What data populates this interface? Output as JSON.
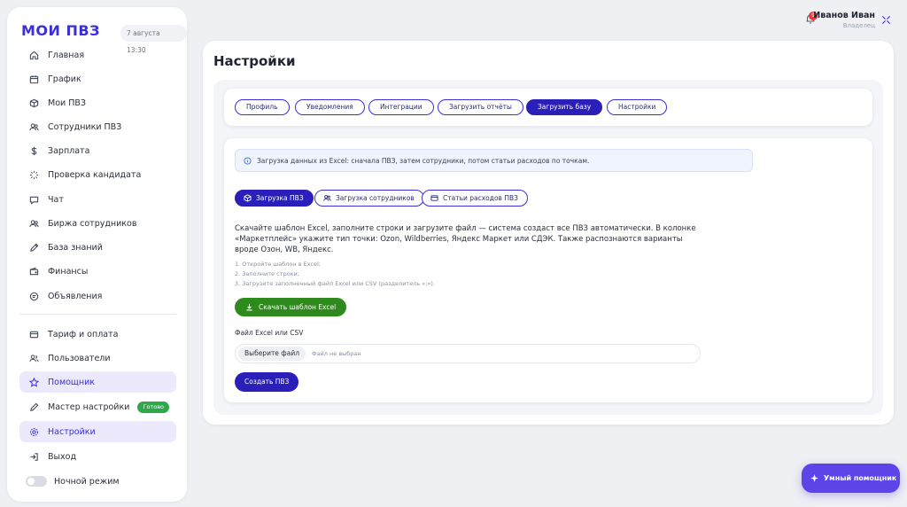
{
  "brand": {
    "logo": "МОИ ПВЗ",
    "date": "7 августа 13:30"
  },
  "sidebar": {
    "items": [
      {
        "label": "Главная",
        "icon": "home-icon"
      },
      {
        "label": "График",
        "icon": "calendar-icon"
      },
      {
        "label": "Мои ПВЗ",
        "icon": "box-icon"
      },
      {
        "label": "Сотрудники ПВЗ",
        "icon": "users-icon"
      },
      {
        "label": "Зарплата",
        "icon": "dollar-icon"
      },
      {
        "label": "Проверка кандидата",
        "icon": "loader-icon"
      },
      {
        "label": "Чат",
        "icon": "chat-icon"
      },
      {
        "label": "Биржа сотрудников",
        "icon": "users-icon"
      },
      {
        "label": "База знаний",
        "icon": "pencil-icon"
      },
      {
        "label": "Финансы",
        "icon": "wallet-icon"
      },
      {
        "label": "Объявления",
        "icon": "megaphone-icon"
      }
    ],
    "items2": [
      {
        "label": "Тариф и оплата",
        "icon": "card-icon"
      },
      {
        "label": "Пользователи",
        "icon": "user-group-icon"
      },
      {
        "label": "Помощник",
        "icon": "star-icon"
      },
      {
        "label": "Мастер настройки",
        "icon": "wand-icon",
        "badge": "Готово"
      },
      {
        "label": "Настройки",
        "icon": "gear-icon"
      },
      {
        "label": "Выход",
        "icon": "logout-icon"
      }
    ],
    "night_mode": "Ночной режим"
  },
  "user": {
    "name": "Иванов Иван",
    "role": "Владелец",
    "notifications": "9"
  },
  "page": {
    "title": "Настройки"
  },
  "tabs": [
    "Профиль",
    "Уведомления",
    "Интеграции",
    "Загрузить отчёты",
    "Загрузить базу",
    "Настройки"
  ],
  "content": {
    "info": "Загрузка данных из Excel: сначала ПВЗ, затем сотрудники, потом статьи расходов по точкам.",
    "subtabs": [
      "Загрузка ПВЗ",
      "Загрузка сотрудников",
      "Статьи расходов ПВЗ"
    ],
    "description": "Скачайте шаблон Excel, заполните строки и загрузите файл — система создаст все ПВЗ автоматически. В колонке «Маркетплейс» укажите тип точки: Ozon, Wildberries, Яндекс Маркет или СДЭК. Также распознаются варианты вроде Озон, WB, Яндекс.",
    "steps": [
      "1. Откройте шаблон в Excel;",
      "2. Заполните строки;",
      "3. Загрузите заполненный файл Excel или CSV (разделитель «;»)."
    ],
    "download_label": "Скачать шаблон Excel",
    "file_label": "Файл Excel или CSV",
    "file_button": "Выберите файл",
    "file_none": "Файл не выбран",
    "create_label": "Создать ПВЗ"
  },
  "assistant": {
    "label": "Умный помощник"
  },
  "colors": {
    "accent": "#3a2fd8",
    "accent_dark": "#2a1fb8",
    "green": "#2e8a1c",
    "badge_green": "#2fa84a"
  }
}
